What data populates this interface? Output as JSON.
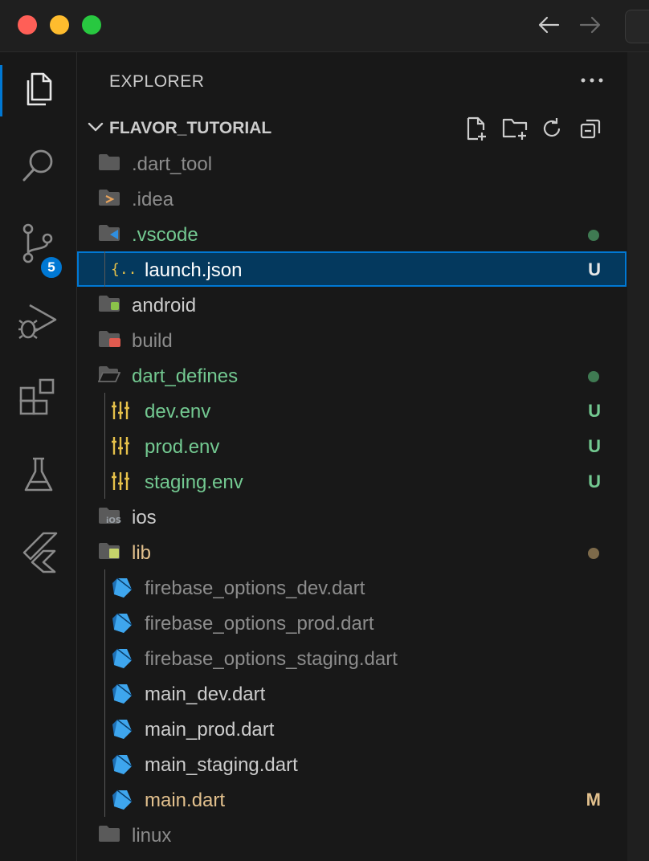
{
  "titlebar": {
    "back_icon": "arrow-left-icon",
    "forward_icon": "arrow-right-icon"
  },
  "activity_bar": {
    "items": [
      {
        "name": "explorer",
        "icon": "files-icon",
        "active": true
      },
      {
        "name": "search",
        "icon": "search-icon"
      },
      {
        "name": "source-control",
        "icon": "source-control-icon",
        "badge": "5"
      },
      {
        "name": "run-debug",
        "icon": "run-debug-icon"
      },
      {
        "name": "extensions",
        "icon": "extensions-icon"
      },
      {
        "name": "testing",
        "icon": "beaker-icon"
      },
      {
        "name": "flutter",
        "icon": "flutter-icon"
      }
    ]
  },
  "explorer": {
    "title": "EXPLORER",
    "folder_name": "FLAVOR_TUTORIAL",
    "actions": [
      "new-file-icon",
      "new-folder-icon",
      "refresh-icon",
      "collapse-all-icon"
    ],
    "tree": [
      {
        "label": ".dart_tool",
        "kind": "folder",
        "icon": "folder-icon",
        "color": "#8c8c8c",
        "status": ""
      },
      {
        "label": ".idea",
        "kind": "folder",
        "icon": "folder-idea-icon",
        "color": "#8c8c8c",
        "status": ""
      },
      {
        "label": ".vscode",
        "kind": "folder",
        "icon": "folder-vscode-icon",
        "color": "#73c991",
        "status": "dot"
      },
      {
        "label": "launch.json",
        "kind": "file",
        "icon": "json-file-icon",
        "color": "#ffffff",
        "status": "U",
        "selected": true
      },
      {
        "label": "android",
        "kind": "folder",
        "icon": "folder-android-icon",
        "color": "#cccccc",
        "status": ""
      },
      {
        "label": "build",
        "kind": "folder",
        "icon": "folder-build-icon",
        "color": "#8c8c8c",
        "status": ""
      },
      {
        "label": "dart_defines",
        "kind": "folder-open",
        "icon": "folder-open-icon",
        "color": "#73c991",
        "status": "dot"
      },
      {
        "label": "dev.env",
        "kind": "file",
        "icon": "env-file-icon",
        "color": "#73c991",
        "status": "U"
      },
      {
        "label": "prod.env",
        "kind": "file",
        "icon": "env-file-icon",
        "color": "#73c991",
        "status": "U"
      },
      {
        "label": "staging.env",
        "kind": "file",
        "icon": "env-file-icon",
        "color": "#73c991",
        "status": "U"
      },
      {
        "label": "ios",
        "kind": "folder",
        "icon": "folder-ios-icon",
        "color": "#cccccc",
        "status": ""
      },
      {
        "label": "lib",
        "kind": "folder",
        "icon": "folder-lib-icon",
        "color": "#e2c08d",
        "status": "dot-modified"
      },
      {
        "label": "firebase_options_dev.dart",
        "kind": "file",
        "icon": "dart-file-icon",
        "color": "#8c8c8c",
        "status": ""
      },
      {
        "label": "firebase_options_prod.dart",
        "kind": "file",
        "icon": "dart-file-icon",
        "color": "#8c8c8c",
        "status": ""
      },
      {
        "label": "firebase_options_staging.dart",
        "kind": "file",
        "icon": "dart-file-icon",
        "color": "#8c8c8c",
        "status": ""
      },
      {
        "label": "main_dev.dart",
        "kind": "file",
        "icon": "dart-file-icon",
        "color": "#cccccc",
        "status": ""
      },
      {
        "label": "main_prod.dart",
        "kind": "file",
        "icon": "dart-file-icon",
        "color": "#cccccc",
        "status": ""
      },
      {
        "label": "main_staging.dart",
        "kind": "file",
        "icon": "dart-file-icon",
        "color": "#cccccc",
        "status": ""
      },
      {
        "label": "main.dart",
        "kind": "file",
        "icon": "dart-file-icon",
        "color": "#e2c08d",
        "status": "M"
      },
      {
        "label": "linux",
        "kind": "folder",
        "icon": "folder-icon",
        "color": "#8c8c8c",
        "status": ""
      }
    ]
  },
  "colors": {
    "accent": "#0078d4",
    "selection_bg": "#04395e",
    "untracked": "#73c991",
    "modified": "#e2c08d",
    "ignored": "#8c8c8c"
  }
}
